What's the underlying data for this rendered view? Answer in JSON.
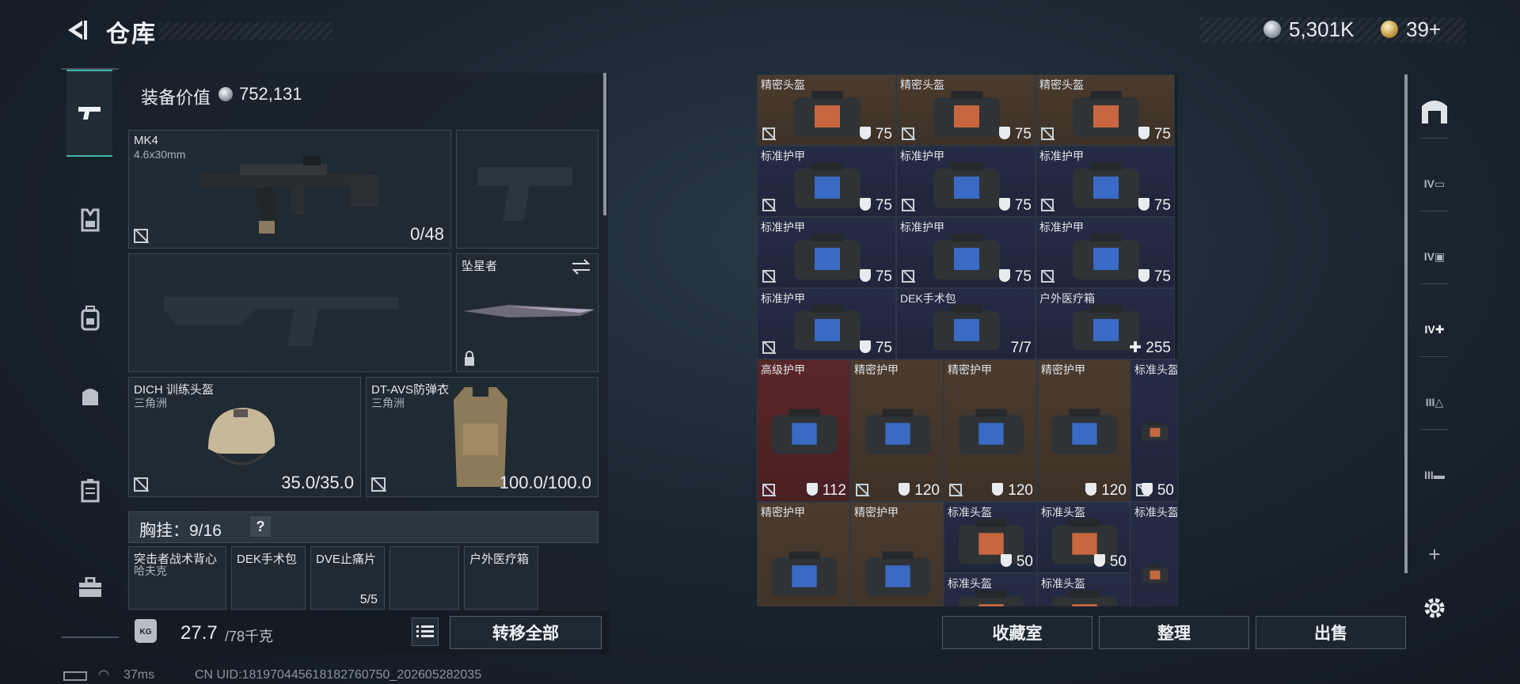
{
  "header": {
    "title": "仓库"
  },
  "currency": {
    "silver": "5,301K",
    "gold": "39+"
  },
  "left_rail": [
    {
      "icon": "pistol-icon"
    },
    {
      "icon": "chest-rig-icon"
    },
    {
      "icon": "backpack-icon"
    },
    {
      "icon": "bag-icon"
    },
    {
      "icon": "case-icon"
    },
    {
      "icon": "toolbox-icon"
    }
  ],
  "loadout": {
    "equip_value_label": "装备价值",
    "equip_value": "752,131",
    "primary_weapon": {
      "name": "MK4",
      "caliber": "4.6x30mm",
      "ammo": "0/48"
    },
    "melee": {
      "name": "坠星者"
    },
    "helmet": {
      "name": "DICH 训练头盔",
      "sub": "三角洲",
      "durability": "35.0/35.0"
    },
    "armor": {
      "name": "DT-AVS防弹衣",
      "sub": "三角洲",
      "durability": "100.0/100.0"
    },
    "chest_rig": {
      "label": "胸挂：",
      "capacity": "9/16",
      "help": "?"
    },
    "rig_items": [
      {
        "name": "突击者战术背心",
        "sub": "哈夫克"
      },
      {
        "name": "DEK手术包",
        "sub": ""
      },
      {
        "name": "DVE止痛片",
        "sub": "",
        "count": "5/5"
      },
      {
        "name": "",
        "sub": ""
      },
      {
        "name": "户外医疗箱",
        "sub": ""
      }
    ]
  },
  "weight": {
    "value": "27.7",
    "capacity": "/78千克",
    "icon_text": "KG"
  },
  "buttons": {
    "transfer_all": "转移全部",
    "collection": "收藏室",
    "organize": "整理",
    "sell": "出售"
  },
  "storage": {
    "rows": [
      [
        {
          "label": "精密头盔",
          "value": "75",
          "color": "brown",
          "shield": true,
          "noins": true
        },
        {
          "label": "精密头盔",
          "value": "75",
          "color": "brown",
          "shield": true,
          "noins": true
        },
        {
          "label": "精密头盔",
          "value": "75",
          "color": "brown",
          "shield": true,
          "noins": true
        }
      ],
      [
        {
          "label": "标准护甲",
          "value": "75",
          "color": "navy",
          "shield": true,
          "noins": true
        },
        {
          "label": "标准护甲",
          "value": "75",
          "color": "navy",
          "shield": true,
          "noins": true
        },
        {
          "label": "标准护甲",
          "value": "75",
          "color": "navy",
          "shield": true,
          "noins": true
        }
      ],
      [
        {
          "label": "标准护甲",
          "value": "75",
          "color": "navy",
          "shield": true,
          "noins": true
        },
        {
          "label": "标准护甲",
          "value": "75",
          "color": "navy",
          "shield": true,
          "noins": true
        },
        {
          "label": "标准护甲",
          "value": "75",
          "color": "navy",
          "shield": true,
          "noins": true
        }
      ],
      [
        {
          "label": "标准护甲",
          "value": "75",
          "color": "navy",
          "shield": true,
          "noins": true
        },
        {
          "label": "DEK手术包",
          "value": "7/7",
          "color": "navy",
          "shield": false,
          "noins": false
        },
        {
          "label": "户外医疗箱",
          "value": "255",
          "color": "navy",
          "shield": false,
          "noins": false,
          "plus": true
        }
      ]
    ],
    "big_rows": [
      [
        {
          "label": "高级护甲",
          "value": "112",
          "color": "red",
          "shield": true,
          "noins": true
        },
        {
          "label": "精密护甲",
          "value": "120",
          "color": "brown",
          "shield": true,
          "noins": true
        },
        {
          "label": "精密护甲",
          "value": "120",
          "color": "brown",
          "shield": true,
          "noins": true
        },
        {
          "label": "精密护甲",
          "value": "120",
          "color": "brown",
          "shield": true,
          "noins": false
        },
        {
          "label": "标准头盔",
          "value": "50",
          "color": "navy",
          "shield": true,
          "noins": true
        }
      ],
      [
        {
          "label": "精密护甲",
          "value": "",
          "color": "brown"
        },
        {
          "label": "精密护甲",
          "value": "",
          "color": "brown"
        },
        {
          "label": "标准头盔",
          "value": "50",
          "color": "navy",
          "shield": true
        },
        {
          "label": "标准头盔",
          "value": "50",
          "color": "navy",
          "shield": true
        },
        {
          "label": "标准头盔",
          "value": "",
          "color": "navy"
        },
        {
          "label": "标准头盔",
          "value": "",
          "color": "navy"
        },
        {
          "label": "标准头盔",
          "value": "",
          "color": "navy"
        }
      ]
    ]
  },
  "right_rail": [
    {
      "icon": "arch-icon",
      "text": ""
    },
    {
      "icon": "storage-iv-icon",
      "text": "IV"
    },
    {
      "icon": "storage-iv-photo-icon",
      "text": "IV"
    },
    {
      "icon": "storage-iv-medical-icon",
      "text": "IV"
    },
    {
      "icon": "storage-iii-triangle-icon",
      "text": "III"
    },
    {
      "icon": "storage-iii-gun-icon",
      "text": "III"
    },
    {
      "icon": "add-icon",
      "text": "+"
    },
    {
      "icon": "settings-icon",
      "text": ""
    }
  ],
  "status": {
    "ping": "37ms",
    "uid": "CN UID:18197044561818276075​0_202605282035"
  },
  "colors": {
    "accent": "#3fb6a8",
    "brown_cell": "#4b3b2e",
    "navy_cell": "#252c45",
    "red_cell": "#5a2628"
  }
}
